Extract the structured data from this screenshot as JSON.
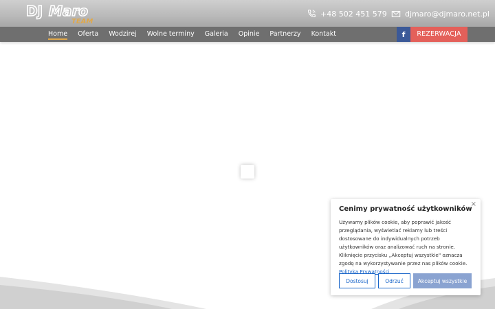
{
  "brand": {
    "logo_text_main": "DJ Maro",
    "logo_text_sub": "TEAM"
  },
  "contact": {
    "phone": "+48 502 451 579",
    "email": "djmaro@djmaro.net.pl"
  },
  "nav": {
    "items": [
      {
        "label": "Home",
        "active": true
      },
      {
        "label": "Oferta",
        "active": false
      },
      {
        "label": "Wodzirej",
        "active": false
      },
      {
        "label": "Wolne terminy",
        "active": false
      },
      {
        "label": "Galeria",
        "active": false
      },
      {
        "label": "Opinie",
        "active": false
      },
      {
        "label": "Partnerzy",
        "active": false
      },
      {
        "label": "Kontakt",
        "active": false
      }
    ],
    "facebook_label": "f",
    "reserve_label": "REZERWACJA"
  },
  "cookie": {
    "title": "Cenimy prywatność użytkowników",
    "text": "Używamy plików cookie, aby poprawić jakość przeglądania, wyświetlać reklamy lub treści dostosowane do indywidualnych potrzeb użytkowników oraz analizować ruch na stronie. Kliknięcie przycisku „Akceptuj wszystkie\" oznacza zgodę na wykorzystywanie przez nas plików cookie.",
    "link_label": "Polityka Prywatności",
    "close_label": "×",
    "customize_label": "Dostosuj",
    "reject_label": "Odrzuć",
    "accept_label": "Akceptuj wszystkie"
  },
  "colors": {
    "reserve": "#e4605a",
    "facebook": "#3b5998",
    "accent": "#e0a84a",
    "link": "#1a66c9"
  }
}
